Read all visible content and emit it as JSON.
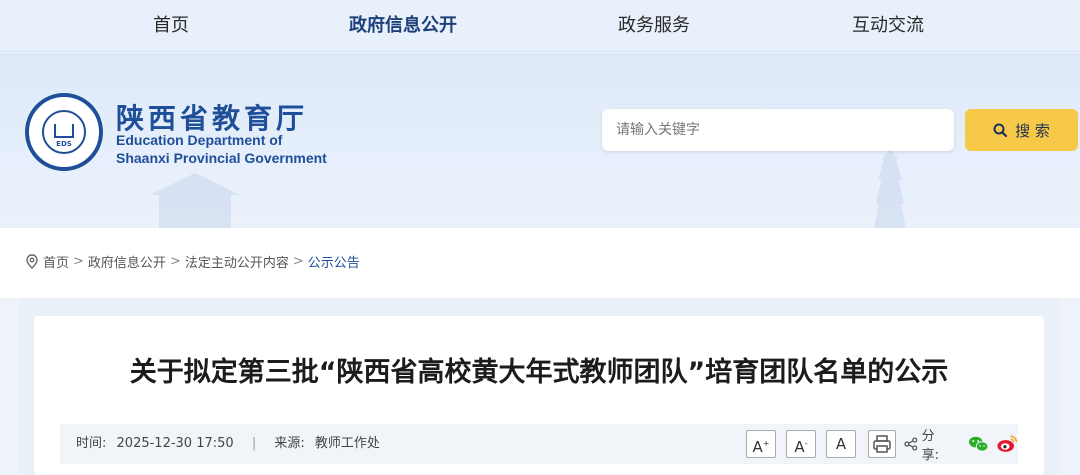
{
  "nav": {
    "items": [
      {
        "label": "首页",
        "active": false
      },
      {
        "label": "政府信息公开",
        "active": true
      },
      {
        "label": "政务服务",
        "active": false
      },
      {
        "label": "互动交流",
        "active": false
      }
    ]
  },
  "header": {
    "logo_emblem_text": "EDS",
    "logo_cn": "陕西省教育厅",
    "logo_en_line1": "Education Department of",
    "logo_en_line2": "Shaanxi Provincial Government"
  },
  "search": {
    "placeholder": "请输入关键字",
    "button_label": "搜 索"
  },
  "breadcrumb": {
    "items": [
      "首页",
      "政府信息公开",
      "法定主动公开内容",
      "公示公告"
    ],
    "separator": ">"
  },
  "article": {
    "title": "关于拟定第三批“陕西省高校黄大年式教师团队”培育团队名单的公示",
    "time_label": "时间:",
    "time_value": "2025-12-30 17:50",
    "meta_divider": "|",
    "source_label": "来源:",
    "source_value": "教师工作处",
    "font_large": "A",
    "font_medium": "A",
    "font_small": "A",
    "share_label": "分享:"
  },
  "colors": {
    "brand_blue": "#1f4f99",
    "search_button": "#f7c948",
    "nav_bg": "#e8f0fb"
  },
  "icons": [
    "location-pin-icon",
    "search-icon",
    "print-icon",
    "share-icon",
    "wechat-icon",
    "weibo-icon"
  ]
}
